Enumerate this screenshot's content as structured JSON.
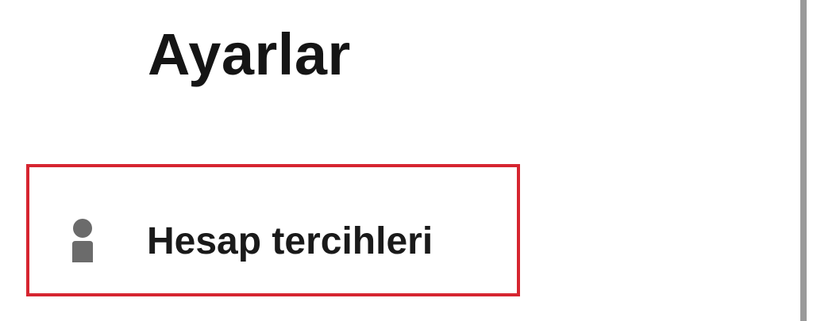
{
  "screen": {
    "title": "Ayarlar"
  },
  "settings": {
    "items": [
      {
        "label": "Hesap tercihleri",
        "icon": "person-icon",
        "highlighted": true
      }
    ]
  },
  "colors": {
    "highlight_border": "#d62530",
    "icon": "#6b6b6b",
    "text": "#1a1a1a",
    "background": "#ffffff"
  }
}
